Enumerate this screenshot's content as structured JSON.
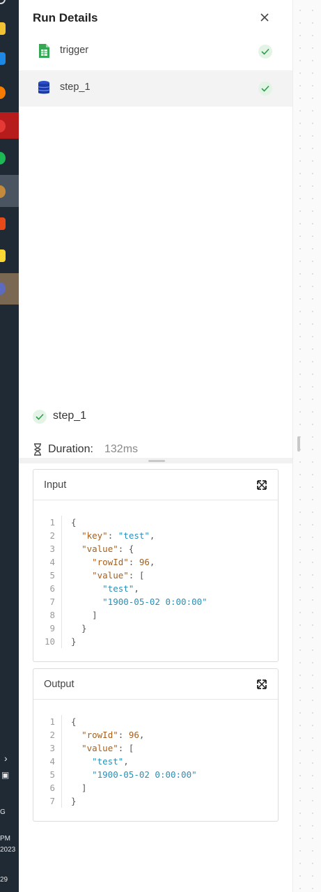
{
  "panel": {
    "title": "Run Details",
    "steps": [
      {
        "label": "trigger",
        "icon": "spreadsheet-icon",
        "status": "success"
      },
      {
        "label": "step_1",
        "icon": "database-icon",
        "status": "success"
      }
    ],
    "selected_step": {
      "label": "step_1",
      "status": "success"
    },
    "duration": {
      "label": "Duration:",
      "value": "132ms"
    }
  },
  "input_card": {
    "title": "Input",
    "lines": [
      {
        "n": "1",
        "tokens": [
          {
            "t": "{",
            "c": "p"
          }
        ]
      },
      {
        "n": "2",
        "tokens": [
          {
            "t": "  ",
            "c": "p"
          },
          {
            "t": "\"key\"",
            "c": "k"
          },
          {
            "t": ": ",
            "c": "p"
          },
          {
            "t": "\"test\"",
            "c": "s"
          },
          {
            "t": ",",
            "c": "p"
          }
        ]
      },
      {
        "n": "3",
        "tokens": [
          {
            "t": "  ",
            "c": "p"
          },
          {
            "t": "\"value\"",
            "c": "k"
          },
          {
            "t": ": {",
            "c": "p"
          }
        ]
      },
      {
        "n": "4",
        "tokens": [
          {
            "t": "    ",
            "c": "p"
          },
          {
            "t": "\"rowId\"",
            "c": "k"
          },
          {
            "t": ": ",
            "c": "p"
          },
          {
            "t": "96",
            "c": "n"
          },
          {
            "t": ",",
            "c": "p"
          }
        ]
      },
      {
        "n": "5",
        "tokens": [
          {
            "t": "    ",
            "c": "p"
          },
          {
            "t": "\"value\"",
            "c": "k"
          },
          {
            "t": ": [",
            "c": "p"
          }
        ]
      },
      {
        "n": "6",
        "tokens": [
          {
            "t": "      ",
            "c": "p"
          },
          {
            "t": "\"test\"",
            "c": "s"
          },
          {
            "t": ",",
            "c": "p"
          }
        ]
      },
      {
        "n": "7",
        "tokens": [
          {
            "t": "      ",
            "c": "p"
          },
          {
            "t": "\"1900-05-02 0:00:00\"",
            "c": "s"
          }
        ]
      },
      {
        "n": "8",
        "tokens": [
          {
            "t": "    ]",
            "c": "p"
          }
        ]
      },
      {
        "n": "9",
        "tokens": [
          {
            "t": "  }",
            "c": "p"
          }
        ]
      },
      {
        "n": "10",
        "tokens": [
          {
            "t": "}",
            "c": "p"
          }
        ]
      }
    ]
  },
  "output_card": {
    "title": "Output",
    "lines": [
      {
        "n": "1",
        "tokens": [
          {
            "t": "{",
            "c": "p"
          }
        ]
      },
      {
        "n": "2",
        "tokens": [
          {
            "t": "  ",
            "c": "p"
          },
          {
            "t": "\"rowId\"",
            "c": "k"
          },
          {
            "t": ": ",
            "c": "p"
          },
          {
            "t": "96",
            "c": "n"
          },
          {
            "t": ",",
            "c": "p"
          }
        ]
      },
      {
        "n": "3",
        "tokens": [
          {
            "t": "  ",
            "c": "p"
          },
          {
            "t": "\"value\"",
            "c": "k"
          },
          {
            "t": ": [",
            "c": "p"
          }
        ]
      },
      {
        "n": "4",
        "tokens": [
          {
            "t": "    ",
            "c": "p"
          },
          {
            "t": "\"test\"",
            "c": "s"
          },
          {
            "t": ",",
            "c": "p"
          }
        ]
      },
      {
        "n": "5",
        "tokens": [
          {
            "t": "    ",
            "c": "p"
          },
          {
            "t": "\"1900-05-02 0:00:00\"",
            "c": "s"
          }
        ]
      },
      {
        "n": "6",
        "tokens": [
          {
            "t": "  ]",
            "c": "p"
          }
        ]
      },
      {
        "n": "7",
        "tokens": [
          {
            "t": "}",
            "c": "p"
          }
        ]
      }
    ]
  },
  "taskbar": {
    "clock_fragments": [
      "PM",
      "2023"
    ],
    "lang_fragment": "G",
    "badge_fragment": "29"
  },
  "colors": {
    "success_bg": "#e3f4e6",
    "success_check": "#2e9d4b",
    "json_key": "#a65f1b",
    "json_string": "#2a8fb7"
  }
}
